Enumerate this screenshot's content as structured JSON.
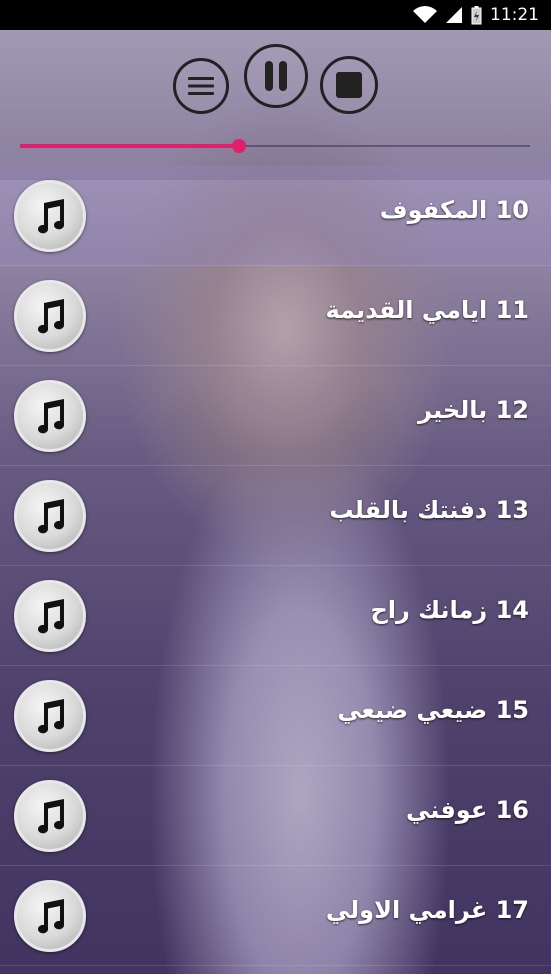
{
  "status_bar": {
    "time": "11:21"
  },
  "player": {
    "progress": 0.43
  },
  "tracks": [
    {
      "title": "10 المكفوف"
    },
    {
      "title": "11 ايامي القديمة"
    },
    {
      "title": "12 بالخير"
    },
    {
      "title": "13 دفنتك بالقلب"
    },
    {
      "title": "14 زمانك راح"
    },
    {
      "title": "15 ضيعي ضيعي"
    },
    {
      "title": "16 عوفني"
    },
    {
      "title": "17 غرامي الاولي"
    }
  ],
  "colors": {
    "accent": "#e0206a"
  }
}
